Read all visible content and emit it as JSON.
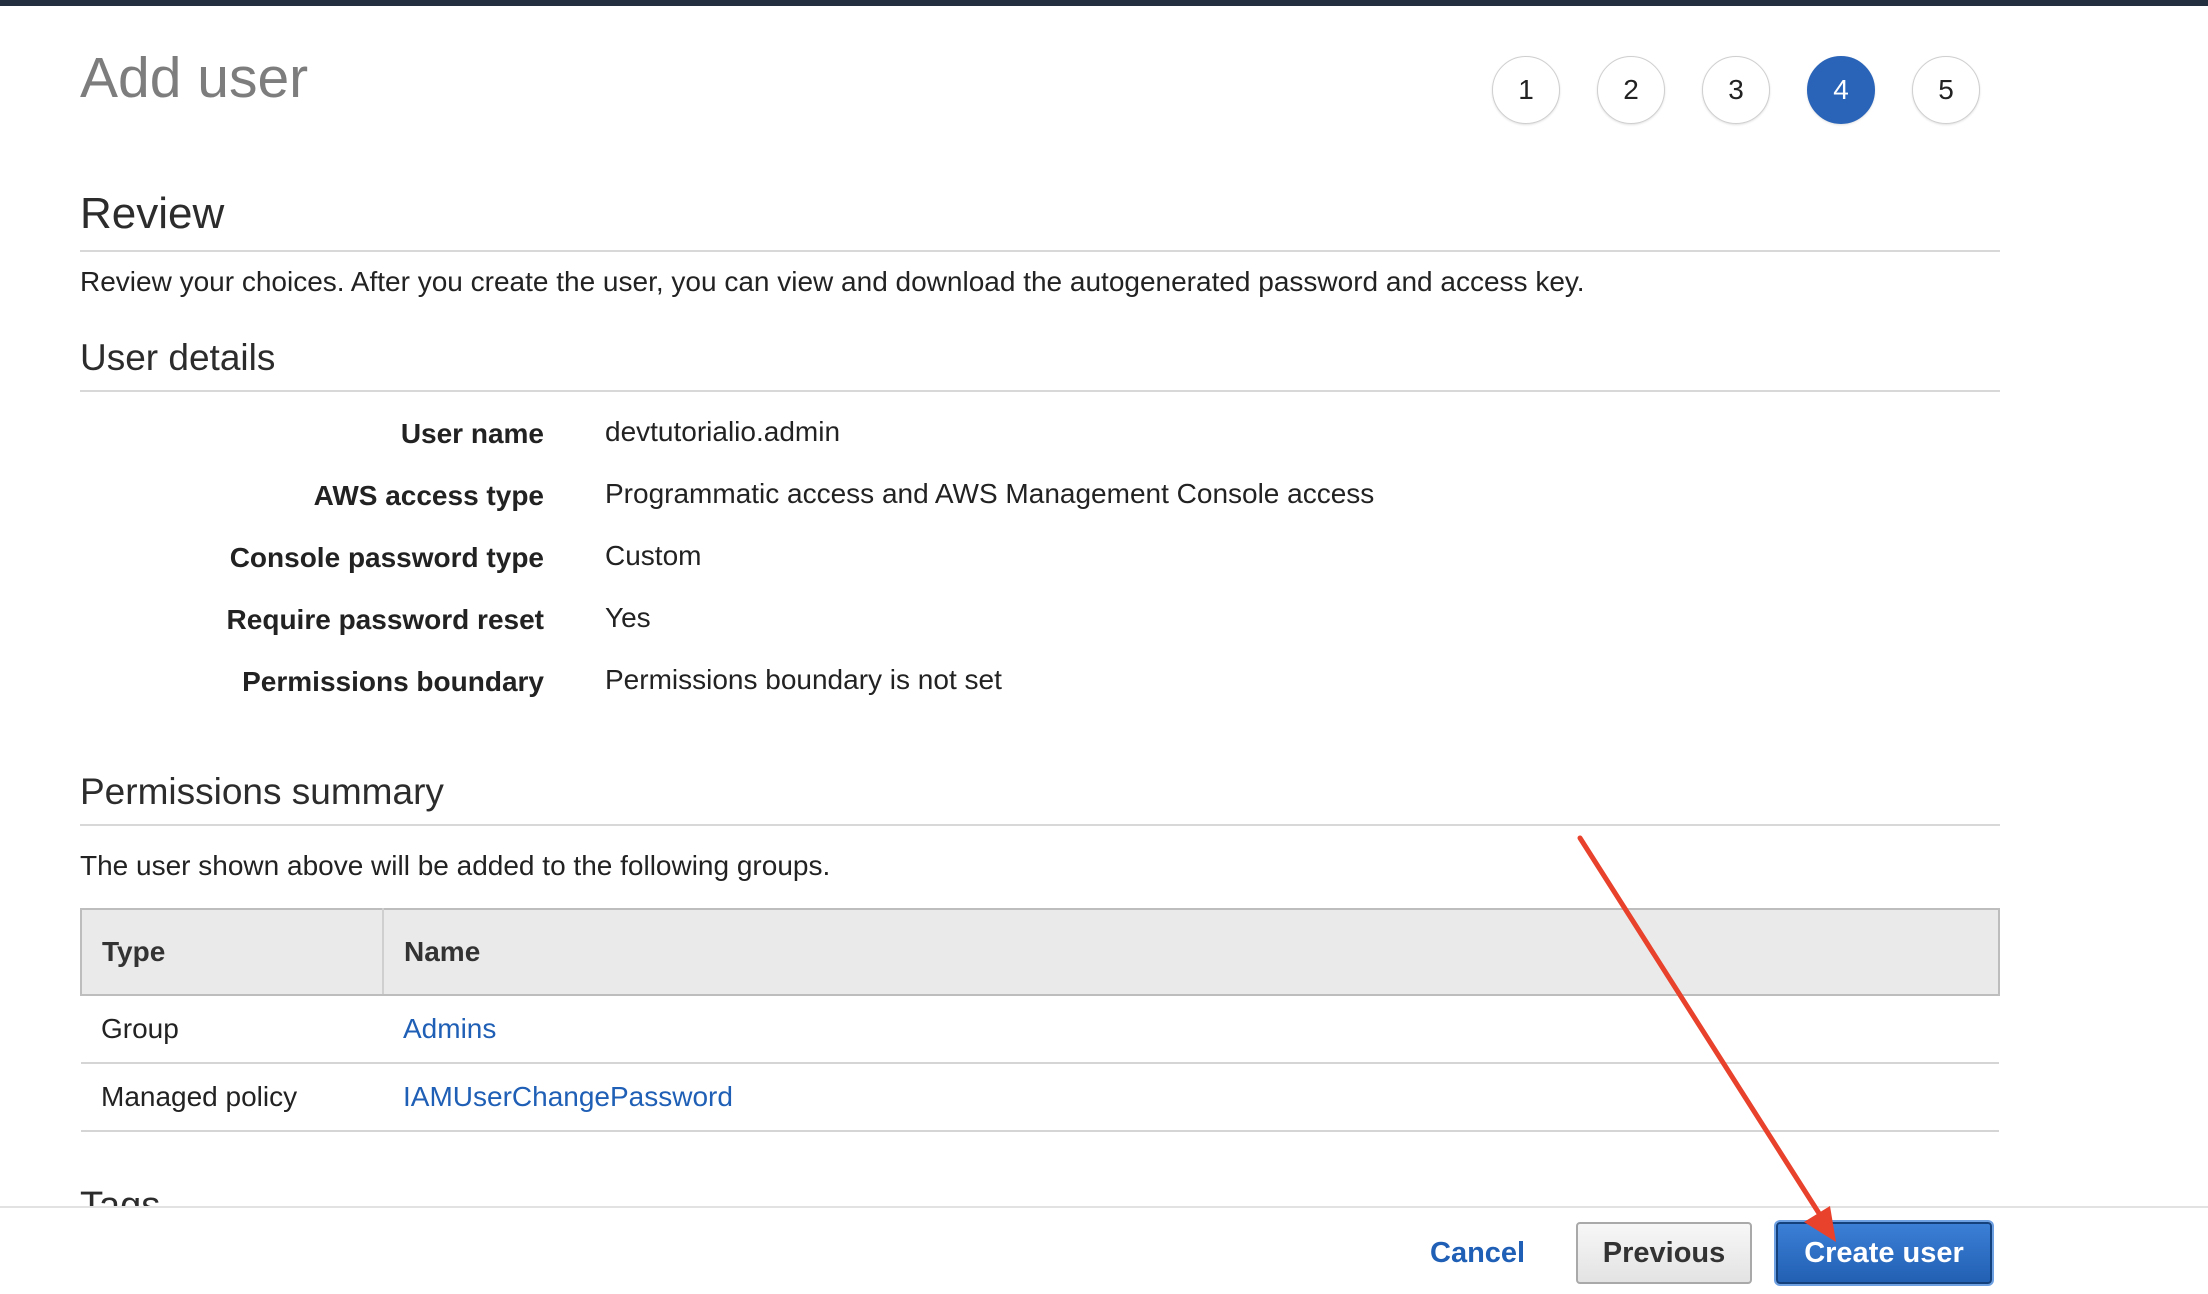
{
  "page": {
    "title": "Add user"
  },
  "steps": [
    "1",
    "2",
    "3",
    "4",
    "5"
  ],
  "active_step": "4",
  "review": {
    "heading": "Review",
    "description": "Review your choices. After you create the user, you can view and download the autogenerated password and access key."
  },
  "user_details": {
    "heading": "User details",
    "rows": [
      {
        "label": "User name",
        "value": "devtutorialio.admin"
      },
      {
        "label": "AWS access type",
        "value": "Programmatic access and AWS Management Console access"
      },
      {
        "label": "Console password type",
        "value": "Custom"
      },
      {
        "label": "Require password reset",
        "value": "Yes"
      },
      {
        "label": "Permissions boundary",
        "value": "Permissions boundary is not set"
      }
    ]
  },
  "permissions_summary": {
    "heading": "Permissions summary",
    "description": "The user shown above will be added to the following groups.",
    "columns": [
      "Type",
      "Name"
    ],
    "rows": [
      {
        "type": "Group",
        "name": "Admins"
      },
      {
        "type": "Managed policy",
        "name": "IAMUserChangePassword"
      }
    ]
  },
  "tags": {
    "heading": "Tags"
  },
  "footer": {
    "cancel_label": "Cancel",
    "previous_label": "Previous",
    "create_label": "Create user"
  },
  "annotation": {
    "arrow_color": "#e8412c"
  },
  "colors": {
    "primary": "#2a64b8",
    "link": "#1f5fb5",
    "topbar": "#232f3e"
  }
}
